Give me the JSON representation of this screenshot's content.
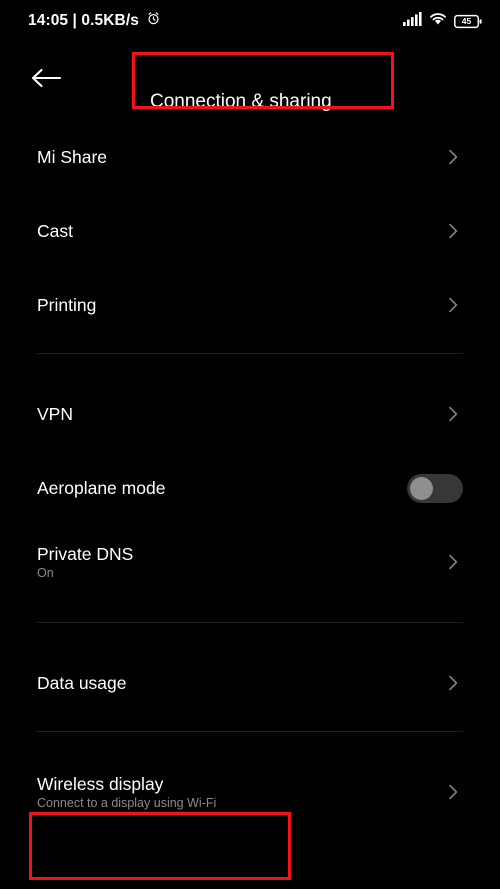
{
  "status_bar": {
    "clock": "14:05",
    "separator": "|",
    "network_speed": "0.5KB/s",
    "clock_full": "14:05 | 0.5KB/s",
    "alarm_icon": "alarm-clock-icon",
    "signal_icon": "cellular-signal-icon",
    "wifi_icon": "wifi-icon",
    "battery_icon": "battery-icon",
    "battery_level": "45"
  },
  "app_bar": {
    "back_icon": "back-arrow-icon",
    "title": "Connection & sharing"
  },
  "colors": {
    "background": "#000000",
    "text_primary": "#ffffff",
    "text_secondary": "#8b8b8b",
    "divider": "#1e1e1e",
    "highlight": "#f1121a",
    "toggle_track_off": "#373737",
    "toggle_knob_off": "#8e8e8e"
  },
  "groups": [
    {
      "items": [
        {
          "title": "Mi Share",
          "subtitle": "",
          "control": "chevron"
        },
        {
          "title": "Cast",
          "subtitle": "",
          "control": "chevron"
        },
        {
          "title": "Printing",
          "subtitle": "",
          "control": "chevron"
        }
      ]
    },
    {
      "items": [
        {
          "title": "VPN",
          "subtitle": "",
          "control": "chevron"
        },
        {
          "title": "Aeroplane mode",
          "subtitle": "",
          "control": "toggle",
          "toggle_state": "off"
        },
        {
          "title": "Private DNS",
          "subtitle": "On",
          "control": "chevron"
        }
      ]
    },
    {
      "items": [
        {
          "title": "Data usage",
          "subtitle": "",
          "control": "chevron"
        }
      ]
    },
    {
      "items": [
        {
          "title": "Wireless display",
          "subtitle": "Connect to a display using Wi-Fi",
          "control": "chevron",
          "highlighted": true
        }
      ]
    }
  ]
}
